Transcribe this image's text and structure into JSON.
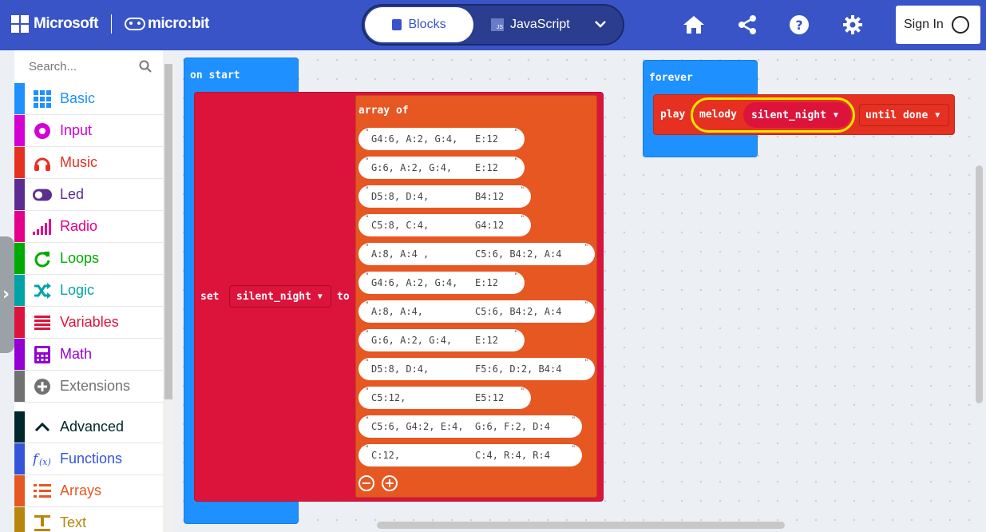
{
  "header": {
    "brand": "Microsoft",
    "product": "micro:bit",
    "modes": {
      "blocks": "Blocks",
      "javascript": "JavaScript"
    },
    "sign_in": "Sign In"
  },
  "toolbox": {
    "search_placeholder": "Search...",
    "categories": [
      {
        "label": "Basic",
        "color": "#1e90ff"
      },
      {
        "label": "Input",
        "color": "#d400d4"
      },
      {
        "label": "Music",
        "color": "#e63022"
      },
      {
        "label": "Led",
        "color": "#5c2d91"
      },
      {
        "label": "Radio",
        "color": "#e3008c"
      },
      {
        "label": "Loops",
        "color": "#00aa00"
      },
      {
        "label": "Logic",
        "color": "#00a4a6"
      },
      {
        "label": "Variables",
        "color": "#dc143c"
      },
      {
        "label": "Math",
        "color": "#9400d3"
      },
      {
        "label": "Extensions",
        "color": "#717171"
      },
      {
        "label": "Advanced",
        "color": "#00272b"
      },
      {
        "label": "Functions",
        "color": "#3455db"
      },
      {
        "label": "Arrays",
        "color": "#e65722"
      },
      {
        "label": "Text",
        "color": "#b8860b"
      }
    ]
  },
  "workspace": {
    "on_start": {
      "label": "on start",
      "set_label": "set",
      "variable": "silent_night",
      "to_label": "to",
      "array_label": "array of",
      "strings": [
        "G4:6, A:2, G:4,   E:12",
        "G:6, A:2, G:4,    E:12",
        "D5:8, D:4,        B4:12",
        "C5:8, C:4,        G4:12",
        "A:8, A:4 ,        C5:6, B4:2, A:4",
        "G4:6, A:2, G:4,   E:12",
        "A:8, A:4,         C5:6, B4:2, A:4",
        "G:6, A:2, G:4,    E:12",
        "D5:8, D:4,        F5:6, D:2, B4:4",
        "C5:12,            E5:12",
        "C5:6, G4:2, E:4,  G:6, F:2, D:4",
        "C:12,             C:4, R:4, R:4"
      ]
    },
    "forever": {
      "label": "forever",
      "play_label": "play",
      "melody_label": "melody",
      "melody_value": "silent_night",
      "mode_value": "until done"
    }
  }
}
